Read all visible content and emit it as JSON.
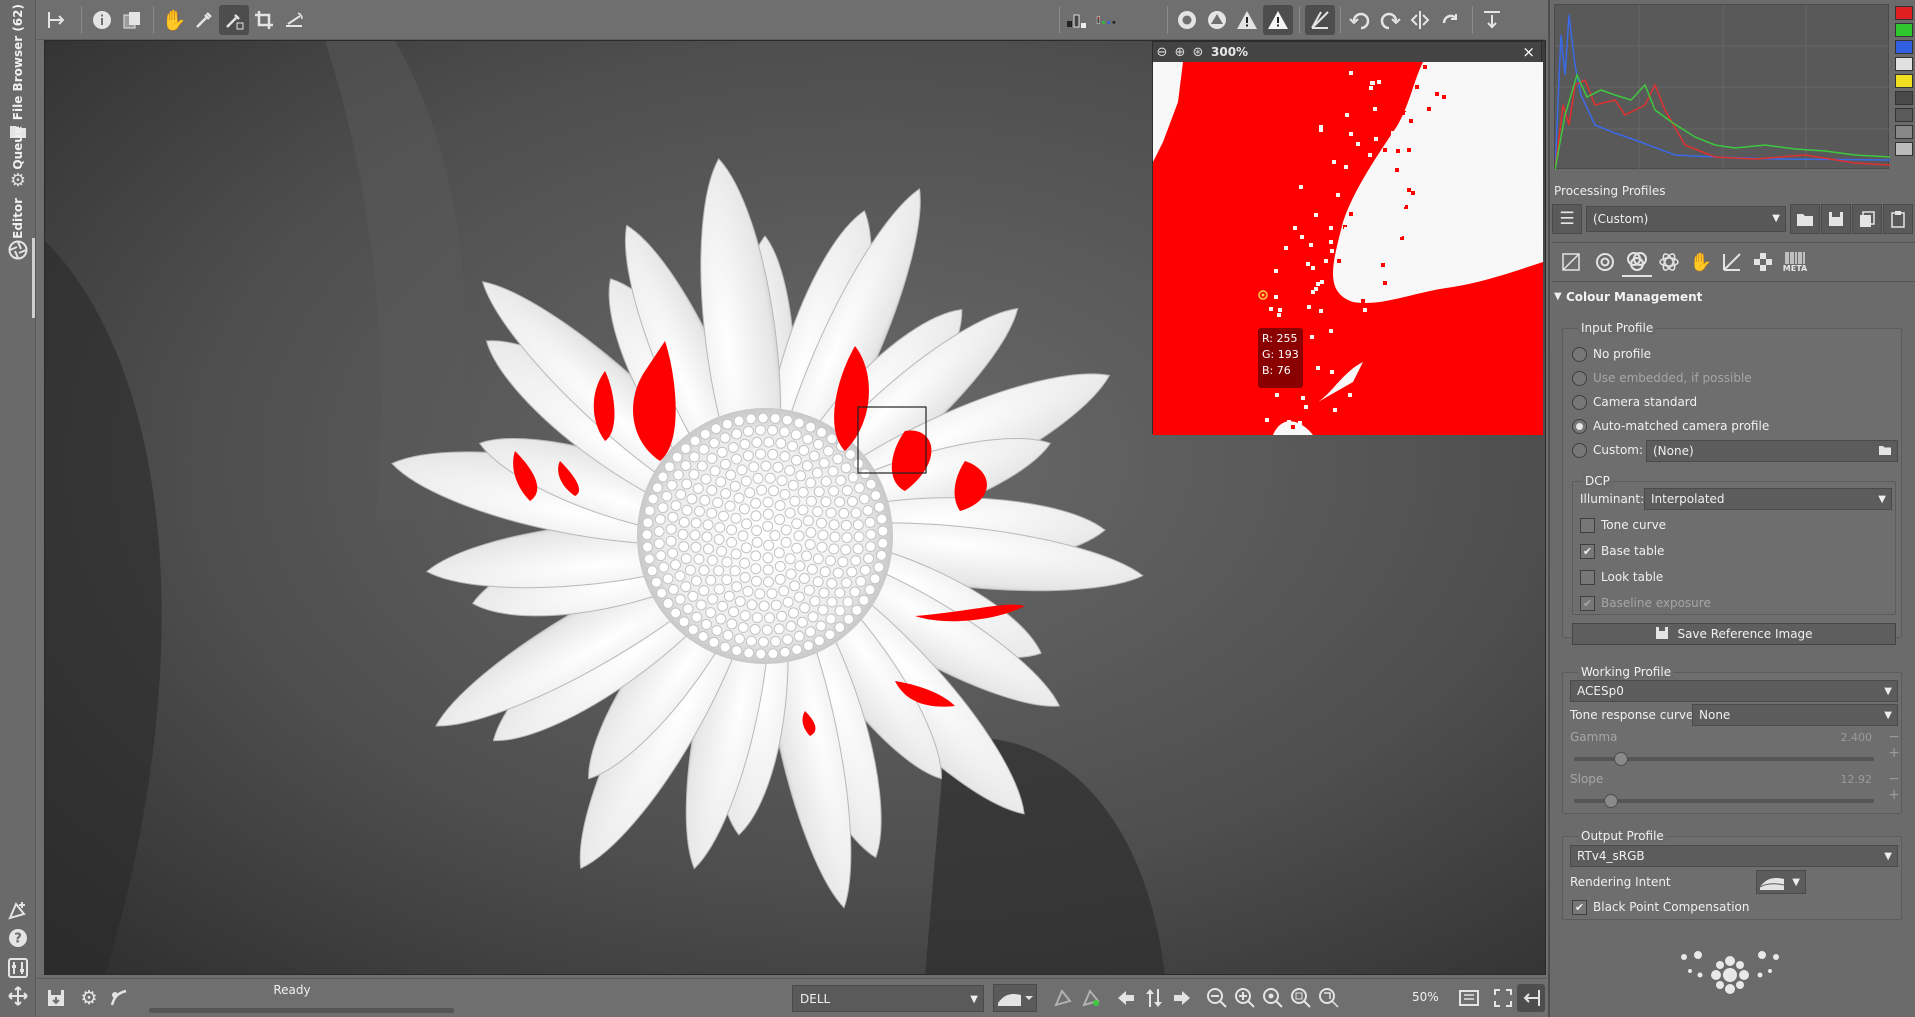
{
  "left_tabs": {
    "file_browser": "File Browser (62)",
    "queue": "Queue",
    "editor": "Editor"
  },
  "navigator": {
    "zoom": "300%",
    "close_label": "×",
    "pixel_r": "R: 255",
    "pixel_g": "G: 193",
    "pixel_b": "B: 76"
  },
  "right_panel": {
    "processing_profiles_label": "Processing Profiles",
    "profile_value": "(Custom)",
    "meta_tab_label": "META",
    "colour_management_title": "Colour Management",
    "input_profile": {
      "legend": "Input Profile",
      "options": [
        "No profile",
        "Use embedded, if possible",
        "Camera standard",
        "Auto-matched camera profile",
        "Custom:"
      ],
      "selected": "Auto-matched camera profile",
      "custom_value": "(None)"
    },
    "dcp": {
      "legend": "DCP",
      "illuminant_label": "Illuminant:",
      "illuminant_value": "Interpolated",
      "tone_curve": "Tone curve",
      "base_table": "Base table",
      "look_table": "Look table",
      "baseline_exposure": "Baseline exposure"
    },
    "save_reference_button": "Save Reference Image",
    "working_profile": {
      "legend": "Working Profile",
      "value": "ACESp0",
      "trc_label": "Tone response curve:",
      "trc_value": "None",
      "gamma_label": "Gamma",
      "gamma_value": "2.400",
      "slope_label": "Slope",
      "slope_value": "12.92"
    },
    "output_profile": {
      "legend": "Output Profile",
      "value": "RTv4_sRGB",
      "rendering_intent_label": "Rendering Intent",
      "bpc_label": "Black Point Compensation"
    }
  },
  "bottom_bar": {
    "status": "Ready",
    "monitor_profile": "DELL",
    "zoom_value": "50%"
  },
  "colors": {
    "clipping_red": "#ff0000",
    "histogram_red": "#e03030",
    "histogram_green": "#3ec83e",
    "histogram_blue": "#3a6ae8"
  }
}
